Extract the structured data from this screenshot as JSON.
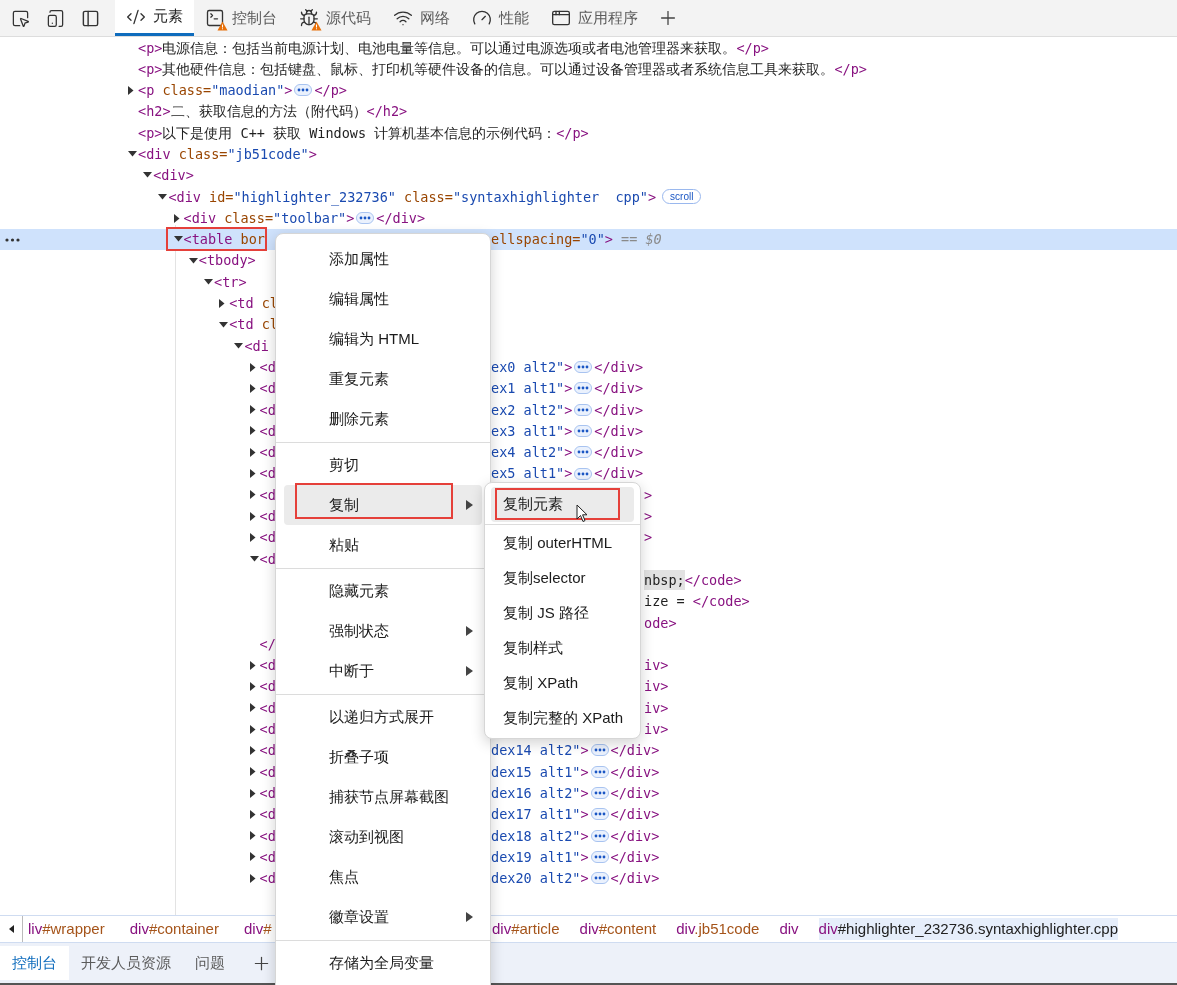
{
  "toolbar": {
    "tabs": [
      {
        "kind": "elements",
        "label": "元素",
        "selected": true,
        "warning": false
      },
      {
        "kind": "console",
        "label": "控制台",
        "selected": false,
        "warning": true
      },
      {
        "kind": "sources",
        "label": "源代码",
        "selected": false,
        "warning": true
      },
      {
        "kind": "network",
        "label": "网络",
        "selected": false,
        "warning": false
      },
      {
        "kind": "performance",
        "label": "性能",
        "selected": false,
        "warning": false
      },
      {
        "kind": "application",
        "label": "应用程序",
        "selected": false,
        "warning": false
      }
    ]
  },
  "tree": [
    {
      "selected": false,
      "segments": [
        {
          "kind": "tag",
          "text": "<p>"
        },
        {
          "kind": "text",
          "text": "电源信息：包括当前电源计划、电池电量等信息。可以通过电源选项或者电池管理器来获取。"
        },
        {
          "kind": "tag",
          "text": "</p>"
        }
      ]
    },
    {
      "selected": false,
      "segments": [
        {
          "kind": "tag",
          "text": "<p>"
        },
        {
          "kind": "text",
          "text": "其他硬件信息：包括键盘、鼠标、打印机等硬件设备的信息。可以通过设备管理器或者系统信息工具来获取。"
        },
        {
          "kind": "tag",
          "text": "</p>"
        }
      ]
    },
    {
      "selected": false,
      "expanded": false,
      "segments": [
        {
          "kind": "tag",
          "text": "<p"
        },
        {
          "kind": "attr",
          "text": " class="
        },
        {
          "kind": "value",
          "text": "\"maodian\""
        },
        {
          "kind": "tag",
          "text": ">"
        },
        {
          "kind": "ellipsis"
        },
        {
          "kind": "tag",
          "text": "</p>"
        }
      ]
    },
    {
      "selected": false,
      "segments": [
        {
          "kind": "tag",
          "text": "<h2>"
        },
        {
          "kind": "text",
          "text": "二、获取信息的方法（附代码）"
        },
        {
          "kind": "tag",
          "text": "</h2>"
        }
      ]
    },
    {
      "selected": false,
      "segments": [
        {
          "kind": "tag",
          "text": "<p>"
        },
        {
          "kind": "text",
          "text": "以下是使用 C++ 获取 Windows 计算机基本信息的示例代码："
        },
        {
          "kind": "tag",
          "text": "</p>"
        }
      ]
    },
    {
      "selected": false,
      "expanded": true,
      "segments": [
        {
          "kind": "tag",
          "text": "<div"
        },
        {
          "kind": "attr",
          "text": " class="
        },
        {
          "kind": "value",
          "text": "\"jb51code\""
        },
        {
          "kind": "tag",
          "text": ">"
        }
      ],
      "children": [
        {
          "selected": false,
          "expanded": true,
          "segments": [
            {
              "kind": "tag",
              "text": "<div>"
            }
          ],
          "children": [
            {
              "selected": false,
              "expanded": true,
              "segments": [
                {
                  "kind": "tag",
                  "text": "<div"
                },
                {
                  "kind": "attr",
                  "text": " id="
                },
                {
                  "kind": "value",
                  "text": "\"highlighter_232736\""
                },
                {
                  "kind": "attr",
                  "text": " class="
                },
                {
                  "kind": "value",
                  "text": "\"syntaxhighlighter  cpp\""
                },
                {
                  "kind": "tag",
                  "text": ">"
                },
                {
                  "kind": "badge",
                  "text": "scroll"
                }
              ],
              "children": [
                {
                  "selected": false,
                  "expanded": false,
                  "segments": [
                    {
                      "kind": "tag",
                      "text": "<div"
                    },
                    {
                      "kind": "attr",
                      "text": " class="
                    },
                    {
                      "kind": "value",
                      "text": "\"toolbar\""
                    },
                    {
                      "kind": "tag",
                      "text": ">"
                    },
                    {
                      "kind": "ellipsis"
                    },
                    {
                      "kind": "tag",
                      "text": "</div>"
                    }
                  ]
                },
                {
                  "selected": true,
                  "annotated": true,
                  "expanded": true,
                  "segments": [
                    {
                      "kind": "tag",
                      "text": "<table"
                    },
                    {
                      "kind": "attr",
                      "text": " bor"
                    }
                  ],
                  "after_menu": [
                    {
                      "kind": "attr",
                      "text": "ellspacing="
                    },
                    {
                      "kind": "value",
                      "text": "\"0\""
                    },
                    {
                      "kind": "tag",
                      "text": ">"
                    },
                    {
                      "kind": "hint",
                      "text": " == $0"
                    }
                  ],
                  "children": [
                    {
                      "selected": false,
                      "expanded": true,
                      "segments": [
                        {
                          "kind": "tag",
                          "text": "<tbody>"
                        }
                      ],
                      "children": [
                        {
                          "selected": false,
                          "expanded": true,
                          "segments": [
                            {
                              "kind": "tag",
                              "text": "<tr>"
                            }
                          ],
                          "children": [
                            {
                              "selected": false,
                              "expanded": false,
                              "segments": [
                                {
                                  "kind": "tag",
                                  "text": "<td"
                                },
                                {
                                  "kind": "attr",
                                  "text": " cl"
                                }
                              ]
                            },
                            {
                              "selected": false,
                              "expanded": true,
                              "segments": [
                                {
                                  "kind": "tag",
                                  "text": "<td"
                                },
                                {
                                  "kind": "attr",
                                  "text": " cl"
                                }
                              ],
                              "children": [
                                {
                                  "selected": false,
                                  "expanded": true,
                                  "segments": [
                                    {
                                      "kind": "tag",
                                      "text": "<di"
                                    }
                                  ],
                                  "children": [
                                    {
                                      "selected": false,
                                      "expanded": false,
                                      "segments": [
                                        {
                                          "kind": "tag",
                                          "text": "<d"
                                        }
                                      ],
                                      "after_menu": [
                                        {
                                          "kind": "value",
                                          "text": "ex0 alt2\""
                                        },
                                        {
                                          "kind": "tag",
                                          "text": ">"
                                        },
                                        {
                                          "kind": "ellipsis"
                                        },
                                        {
                                          "kind": "tag",
                                          "text": "</div>"
                                        }
                                      ]
                                    },
                                    {
                                      "selected": false,
                                      "expanded": false,
                                      "segments": [
                                        {
                                          "kind": "tag",
                                          "text": "<d"
                                        }
                                      ],
                                      "after_menu": [
                                        {
                                          "kind": "value",
                                          "text": "ex1 alt1\""
                                        },
                                        {
                                          "kind": "tag",
                                          "text": ">"
                                        },
                                        {
                                          "kind": "ellipsis"
                                        },
                                        {
                                          "kind": "tag",
                                          "text": "</div>"
                                        }
                                      ]
                                    },
                                    {
                                      "selected": false,
                                      "expanded": false,
                                      "segments": [
                                        {
                                          "kind": "tag",
                                          "text": "<d"
                                        }
                                      ],
                                      "after_menu": [
                                        {
                                          "kind": "value",
                                          "text": "ex2 alt2\""
                                        },
                                        {
                                          "kind": "tag",
                                          "text": ">"
                                        },
                                        {
                                          "kind": "ellipsis"
                                        },
                                        {
                                          "kind": "tag",
                                          "text": "</div>"
                                        }
                                      ]
                                    },
                                    {
                                      "selected": false,
                                      "expanded": false,
                                      "segments": [
                                        {
                                          "kind": "tag",
                                          "text": "<d"
                                        }
                                      ],
                                      "after_menu": [
                                        {
                                          "kind": "value",
                                          "text": "ex3 alt1\""
                                        },
                                        {
                                          "kind": "tag",
                                          "text": ">"
                                        },
                                        {
                                          "kind": "ellipsis"
                                        },
                                        {
                                          "kind": "tag",
                                          "text": "</div>"
                                        }
                                      ]
                                    },
                                    {
                                      "selected": false,
                                      "expanded": false,
                                      "segments": [
                                        {
                                          "kind": "tag",
                                          "text": "<d"
                                        }
                                      ],
                                      "after_menu": [
                                        {
                                          "kind": "value",
                                          "text": "ex4 alt2\""
                                        },
                                        {
                                          "kind": "tag",
                                          "text": ">"
                                        },
                                        {
                                          "kind": "ellipsis"
                                        },
                                        {
                                          "kind": "tag",
                                          "text": "</div>"
                                        }
                                      ]
                                    },
                                    {
                                      "selected": false,
                                      "expanded": false,
                                      "segments": [
                                        {
                                          "kind": "tag",
                                          "text": "<d"
                                        }
                                      ],
                                      "after_menu": [
                                        {
                                          "kind": "value",
                                          "text": "ex5 alt1\""
                                        },
                                        {
                                          "kind": "tag",
                                          "text": ">"
                                        },
                                        {
                                          "kind": "ellipsis"
                                        },
                                        {
                                          "kind": "tag",
                                          "text": "</div>"
                                        }
                                      ]
                                    },
                                    {
                                      "selected": false,
                                      "expanded": false,
                                      "segments": [
                                        {
                                          "kind": "tag",
                                          "text": "<d"
                                        }
                                      ],
                                      "after_submenu": [
                                        {
                                          "kind": "tag",
                                          "text": ">"
                                        }
                                      ]
                                    },
                                    {
                                      "selected": false,
                                      "expanded": false,
                                      "segments": [
                                        {
                                          "kind": "tag",
                                          "text": "<d"
                                        }
                                      ],
                                      "after_submenu": [
                                        {
                                          "kind": "tag",
                                          "text": ">"
                                        }
                                      ]
                                    },
                                    {
                                      "selected": false,
                                      "expanded": false,
                                      "segments": [
                                        {
                                          "kind": "tag",
                                          "text": "<d"
                                        }
                                      ],
                                      "after_submenu": [
                                        {
                                          "kind": "tag",
                                          "text": ">"
                                        }
                                      ]
                                    },
                                    {
                                      "selected": false,
                                      "expanded": true,
                                      "segments": [
                                        {
                                          "kind": "tag",
                                          "text": "<d"
                                        }
                                      ],
                                      "children": [
                                        {
                                          "selected": false,
                                          "after_submenu": [
                                            {
                                              "kind": "nbsp",
                                              "text": "nbsp;"
                                            },
                                            {
                                              "kind": "tag",
                                              "text": "</code>"
                                            }
                                          ]
                                        },
                                        {
                                          "selected": false,
                                          "after_submenu": [
                                            {
                                              "kind": "text",
                                              "text": "ize = "
                                            },
                                            {
                                              "kind": "tag",
                                              "text": "</code>"
                                            }
                                          ]
                                        },
                                        {
                                          "selected": false,
                                          "after_submenu": [
                                            {
                                              "kind": "tag",
                                              "text": "ode>"
                                            }
                                          ]
                                        }
                                      ]
                                    },
                                    {
                                      "selected": false,
                                      "segments": [
                                        {
                                          "kind": "tag",
                                          "text": "</"
                                        }
                                      ]
                                    },
                                    {
                                      "selected": false,
                                      "expanded": false,
                                      "segments": [
                                        {
                                          "kind": "tag",
                                          "text": "<d"
                                        }
                                      ],
                                      "after_submenu": [
                                        {
                                          "kind": "tag",
                                          "text": "iv>"
                                        }
                                      ]
                                    },
                                    {
                                      "selected": false,
                                      "expanded": false,
                                      "segments": [
                                        {
                                          "kind": "tag",
                                          "text": "<d"
                                        }
                                      ],
                                      "after_submenu": [
                                        {
                                          "kind": "tag",
                                          "text": "iv>"
                                        }
                                      ]
                                    },
                                    {
                                      "selected": false,
                                      "expanded": false,
                                      "segments": [
                                        {
                                          "kind": "tag",
                                          "text": "<d"
                                        }
                                      ],
                                      "after_submenu": [
                                        {
                                          "kind": "tag",
                                          "text": "iv>"
                                        }
                                      ]
                                    },
                                    {
                                      "selected": false,
                                      "expanded": false,
                                      "segments": [
                                        {
                                          "kind": "tag",
                                          "text": "<d"
                                        }
                                      ],
                                      "after_submenu": [
                                        {
                                          "kind": "tag",
                                          "text": "iv>"
                                        }
                                      ]
                                    },
                                    {
                                      "selected": false,
                                      "expanded": false,
                                      "segments": [
                                        {
                                          "kind": "tag",
                                          "text": "<d"
                                        }
                                      ],
                                      "after_menu": [
                                        {
                                          "kind": "value",
                                          "text": "dex14 alt2\""
                                        },
                                        {
                                          "kind": "tag",
                                          "text": ">"
                                        },
                                        {
                                          "kind": "ellipsis"
                                        },
                                        {
                                          "kind": "tag",
                                          "text": "</div>"
                                        }
                                      ]
                                    },
                                    {
                                      "selected": false,
                                      "expanded": false,
                                      "segments": [
                                        {
                                          "kind": "tag",
                                          "text": "<d"
                                        }
                                      ],
                                      "after_menu": [
                                        {
                                          "kind": "value",
                                          "text": "dex15 alt1\""
                                        },
                                        {
                                          "kind": "tag",
                                          "text": ">"
                                        },
                                        {
                                          "kind": "ellipsis"
                                        },
                                        {
                                          "kind": "tag",
                                          "text": "</div>"
                                        }
                                      ]
                                    },
                                    {
                                      "selected": false,
                                      "expanded": false,
                                      "segments": [
                                        {
                                          "kind": "tag",
                                          "text": "<d"
                                        }
                                      ],
                                      "after_menu": [
                                        {
                                          "kind": "value",
                                          "text": "dex16 alt2\""
                                        },
                                        {
                                          "kind": "tag",
                                          "text": ">"
                                        },
                                        {
                                          "kind": "ellipsis"
                                        },
                                        {
                                          "kind": "tag",
                                          "text": "</div>"
                                        }
                                      ]
                                    },
                                    {
                                      "selected": false,
                                      "expanded": false,
                                      "segments": [
                                        {
                                          "kind": "tag",
                                          "text": "<d"
                                        }
                                      ],
                                      "after_menu": [
                                        {
                                          "kind": "value",
                                          "text": "dex17 alt1\""
                                        },
                                        {
                                          "kind": "tag",
                                          "text": ">"
                                        },
                                        {
                                          "kind": "ellipsis"
                                        },
                                        {
                                          "kind": "tag",
                                          "text": "</div>"
                                        }
                                      ]
                                    },
                                    {
                                      "selected": false,
                                      "expanded": false,
                                      "segments": [
                                        {
                                          "kind": "tag",
                                          "text": "<d"
                                        }
                                      ],
                                      "after_menu": [
                                        {
                                          "kind": "value",
                                          "text": "dex18 alt2\""
                                        },
                                        {
                                          "kind": "tag",
                                          "text": ">"
                                        },
                                        {
                                          "kind": "ellipsis"
                                        },
                                        {
                                          "kind": "tag",
                                          "text": "</div>"
                                        }
                                      ]
                                    },
                                    {
                                      "selected": false,
                                      "expanded": false,
                                      "segments": [
                                        {
                                          "kind": "tag",
                                          "text": "<d"
                                        }
                                      ],
                                      "after_menu": [
                                        {
                                          "kind": "value",
                                          "text": "dex19 alt1\""
                                        },
                                        {
                                          "kind": "tag",
                                          "text": ">"
                                        },
                                        {
                                          "kind": "ellipsis"
                                        },
                                        {
                                          "kind": "tag",
                                          "text": "</div>"
                                        }
                                      ]
                                    },
                                    {
                                      "selected": false,
                                      "expanded": false,
                                      "segments": [
                                        {
                                          "kind": "tag",
                                          "text": "<d"
                                        }
                                      ],
                                      "after_menu": [
                                        {
                                          "kind": "value",
                                          "text": "dex20 alt2\""
                                        },
                                        {
                                          "kind": "tag",
                                          "text": ">"
                                        },
                                        {
                                          "kind": "ellipsis"
                                        },
                                        {
                                          "kind": "tag",
                                          "text": "</div>"
                                        }
                                      ]
                                    }
                                  ]
                                }
                              ]
                            }
                          ]
                        }
                      ]
                    }
                  ]
                }
              ]
            }
          ]
        }
      ]
    }
  ],
  "breadcrumbs": {
    "before_menu": [
      {
        "tag": "liv",
        "suffix": "#wrapper",
        "selected": false
      },
      {
        "tag": "div",
        "suffix": "#container",
        "selected": false
      },
      {
        "tag": "div",
        "suffix": "#",
        "selected": false
      }
    ],
    "after_menu": [
      {
        "tag": "div",
        "suffix": "#article",
        "selected": false
      },
      {
        "tag": "div",
        "suffix": "#content",
        "selected": false
      },
      {
        "tag": "div",
        "suffix": ".jb51code",
        "selected": false
      },
      {
        "tag": "div",
        "selected": false
      },
      {
        "tag": "div",
        "suffix": "#highlighter_232736.syntaxhighlighter.cpp",
        "selected": true
      }
    ]
  },
  "drawer_tabs": [
    {
      "label": "控制台",
      "selected": true
    },
    {
      "label": "开发人员资源",
      "selected": false
    },
    {
      "label": "问题",
      "selected": false
    }
  ],
  "context_menu": {
    "items": [
      {
        "kind": "item",
        "label": "添加属性",
        "has_submenu": false,
        "highlighted": false,
        "annotated": false
      },
      {
        "kind": "item",
        "label": "编辑属性",
        "has_submenu": false,
        "highlighted": false,
        "annotated": false
      },
      {
        "kind": "item",
        "label": "编辑为 HTML",
        "has_submenu": false,
        "highlighted": false,
        "annotated": false
      },
      {
        "kind": "item",
        "label": "重复元素",
        "has_submenu": false,
        "highlighted": false,
        "annotated": false
      },
      {
        "kind": "item",
        "label": "删除元素",
        "has_submenu": false,
        "highlighted": false,
        "annotated": false
      },
      {
        "kind": "divider"
      },
      {
        "kind": "item",
        "label": "剪切",
        "has_submenu": false,
        "highlighted": false,
        "annotated": false
      },
      {
        "kind": "item",
        "label": "复制",
        "has_submenu": true,
        "highlighted": true,
        "annotated": true
      },
      {
        "kind": "item",
        "label": "粘贴",
        "has_submenu": false,
        "highlighted": false,
        "annotated": false
      },
      {
        "kind": "divider"
      },
      {
        "kind": "item",
        "label": "隐藏元素",
        "has_submenu": false,
        "highlighted": false,
        "annotated": false
      },
      {
        "kind": "item",
        "label": "强制状态",
        "has_submenu": true,
        "highlighted": false,
        "annotated": false
      },
      {
        "kind": "item",
        "label": "中断于",
        "has_submenu": true,
        "highlighted": false,
        "annotated": false
      },
      {
        "kind": "divider"
      },
      {
        "kind": "item",
        "label": "以递归方式展开",
        "has_submenu": false,
        "highlighted": false,
        "annotated": false
      },
      {
        "kind": "item",
        "label": "折叠子项",
        "has_submenu": false,
        "highlighted": false,
        "annotated": false
      },
      {
        "kind": "item",
        "label": "捕获节点屏幕截图",
        "has_submenu": false,
        "highlighted": false,
        "annotated": false
      },
      {
        "kind": "item",
        "label": "滚动到视图",
        "has_submenu": false,
        "highlighted": false,
        "annotated": false
      },
      {
        "kind": "item",
        "label": "焦点",
        "has_submenu": false,
        "highlighted": false,
        "annotated": false
      },
      {
        "kind": "item",
        "label": "徽章设置",
        "has_submenu": true,
        "highlighted": false,
        "annotated": false
      },
      {
        "kind": "divider"
      },
      {
        "kind": "item",
        "label": "存储为全局变量",
        "has_submenu": false,
        "highlighted": false,
        "annotated": false
      }
    ]
  },
  "submenu": {
    "items": [
      {
        "kind": "item",
        "label": "复制元素",
        "highlighted": true,
        "annotated": true
      },
      {
        "kind": "divider"
      },
      {
        "kind": "item",
        "label": "复制 outerHTML",
        "highlighted": false,
        "annotated": false
      },
      {
        "kind": "item",
        "label": "复制selector",
        "highlighted": false,
        "annotated": false
      },
      {
        "kind": "item",
        "label": "复制 JS 路径",
        "highlighted": false,
        "annotated": false
      },
      {
        "kind": "item",
        "label": "复制样式",
        "highlighted": false,
        "annotated": false
      },
      {
        "kind": "item",
        "label": "复制 XPath",
        "highlighted": false,
        "annotated": false
      },
      {
        "kind": "item",
        "label": "复制完整的 XPath",
        "highlighted": false,
        "annotated": false
      }
    ]
  }
}
